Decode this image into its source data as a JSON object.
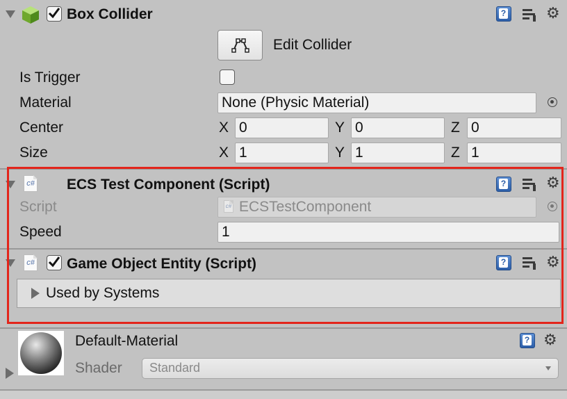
{
  "box_collider": {
    "title": "Box Collider",
    "enabled": true,
    "edit_collider_label": "Edit Collider",
    "is_trigger_label": "Is Trigger",
    "is_trigger": false,
    "material_label": "Material",
    "material_value": "None (Physic Material)",
    "center_label": "Center",
    "center": {
      "x_label": "X",
      "x": "0",
      "y_label": "Y",
      "y": "0",
      "z_label": "Z",
      "z": "0"
    },
    "size_label": "Size",
    "size": {
      "x_label": "X",
      "x": "1",
      "y_label": "Y",
      "y": "1",
      "z_label": "Z",
      "z": "1"
    }
  },
  "ecs_test_component": {
    "title": "ECS Test Component (Script)",
    "icon_text": "c#",
    "script_label": "Script",
    "script_value": "ECSTestComponent",
    "speed_label": "Speed",
    "speed_value": "1"
  },
  "game_object_entity": {
    "title": "Game Object Entity (Script)",
    "icon_text": "c#",
    "enabled": true,
    "used_by_systems_label": "Used by Systems"
  },
  "material": {
    "title": "Default-Material",
    "shader_label": "Shader",
    "shader_value": "Standard"
  },
  "icons": {
    "help": "help-icon",
    "preset": "preset-icon",
    "settings": "gear-icon",
    "help_glyph": "?",
    "gear_glyph": "⚙"
  },
  "colors": {
    "inspector_bg": "#c2c2c2",
    "highlight": "#e3251b",
    "help_blue": "#2c5ea8"
  }
}
